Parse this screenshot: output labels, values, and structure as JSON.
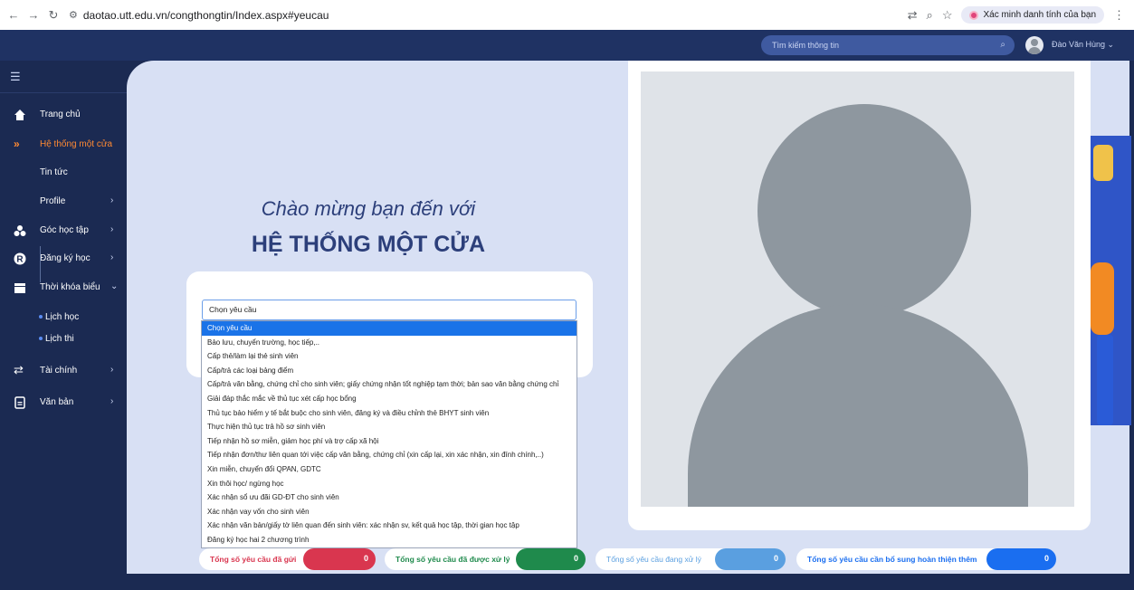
{
  "browser": {
    "url": "daotao.utt.edu.vn/congthongtin/Index.aspx#yeucau",
    "verify_label": "Xác minh danh tính của bạn"
  },
  "header": {
    "search_placeholder": "Tìm kiếm thông tin",
    "user_name": "Đào Văn Hùng"
  },
  "sidebar": {
    "items": [
      {
        "label": "Trang chủ",
        "icon": "home-icon"
      },
      {
        "label": "Hệ thống một cửa",
        "icon": "double-chevron-right-icon",
        "active": true
      },
      {
        "label": "Tin tức"
      },
      {
        "label": "Profile"
      },
      {
        "label": "Góc học tập",
        "icon": "group-icon"
      },
      {
        "label": "Đăng ký học",
        "icon": "r-circle-icon"
      },
      {
        "label": "Thời khóa biểu",
        "icon": "calendar-icon"
      },
      {
        "label": "Tài chính",
        "icon": "transfer-arrows-icon"
      },
      {
        "label": "Văn bản",
        "icon": "document-icon"
      }
    ],
    "subitems": [
      {
        "label": "Lịch học"
      },
      {
        "label": "Lịch thi"
      }
    ]
  },
  "main": {
    "welcome": "Chào mừng bạn đến với",
    "title": "HỆ THỐNG MỘT CỬA",
    "select_value": "Chọn yêu cầu",
    "options": [
      "Chọn yêu cầu",
      "Bảo lưu, chuyển trường, học tiếp,..",
      "Cấp thẻ/làm lại thẻ sinh viên",
      "Cấp/trả các loại bảng điểm",
      "Cấp/trả văn bằng, chứng chỉ cho sinh viên; giấy chứng nhận tốt nghiệp tạm thời; bản sao văn bằng chứng chỉ",
      "Giải đáp thắc mắc về thủ tục xét cấp học bổng",
      "Thủ tục bảo hiểm y tế bắt buộc cho sinh viên, đăng ký và điều chỉnh thẻ BHYT sinh viên",
      "Thực hiện thủ tục trả hồ sơ sinh viên",
      "Tiếp nhận hồ sơ miễn, giảm học phí và trợ cấp xã hội",
      "Tiếp nhận đơn/thư liên quan tới việc cấp văn bằng, chứng chỉ (xin cấp lại, xin xác nhận, xin đính chính,..)",
      "Xin miễn, chuyển đổi QPAN, GDTC",
      "Xin thôi học/ ngừng học",
      "Xác nhận sổ ưu đãi GD-ĐT cho sinh viên",
      "Xác nhận vay vốn cho sinh viên",
      "Xác nhận văn bản/giấy tờ liên quan đến sinh viên: xác nhận sv, kết quả học tập, thời gian học tập",
      "Đăng ký học hai 2 chương trình"
    ]
  },
  "stats": [
    {
      "label": "Tổng số yêu cầu đã gửi",
      "value": "0",
      "color": "#d9364f"
    },
    {
      "label": "Tổng số yêu cầu đã được xử lý",
      "value": "0",
      "color": "#1f8a4c"
    },
    {
      "label": "Tổng số yêu cầu đang xử lý",
      "value": "0",
      "color": "#5a9fe0"
    },
    {
      "label": "Tổng số yêu cầu cần bổ sung hoàn thiện thêm",
      "value": "0",
      "color": "#1a6ef0"
    }
  ]
}
